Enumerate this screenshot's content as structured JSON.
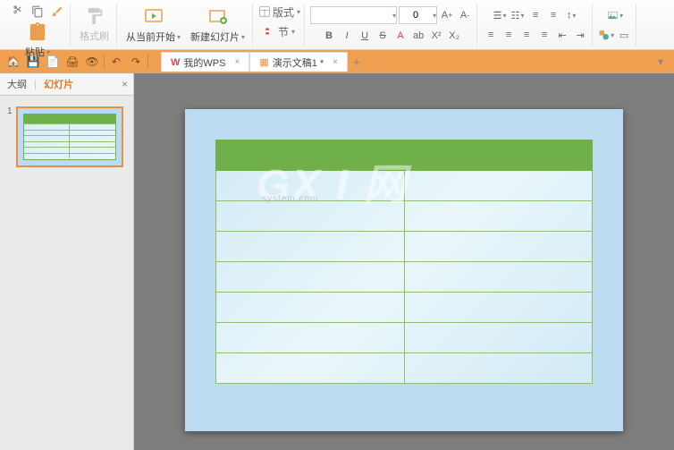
{
  "ribbon": {
    "paste": "粘贴",
    "format_painter": "格式刷",
    "from_current": "从当前开始",
    "new_slide": "新建幻灯片",
    "layout": "版式",
    "section": "节",
    "font_name": "",
    "font_size": "0"
  },
  "tabs": {
    "wps": "我的WPS",
    "doc": "演示文稿1 *"
  },
  "sidebar": {
    "outline": "大纲",
    "slides": "幻灯片",
    "thumb_num": "1"
  },
  "watermark": {
    "main": "GX I 网",
    "sub": "system.com"
  }
}
